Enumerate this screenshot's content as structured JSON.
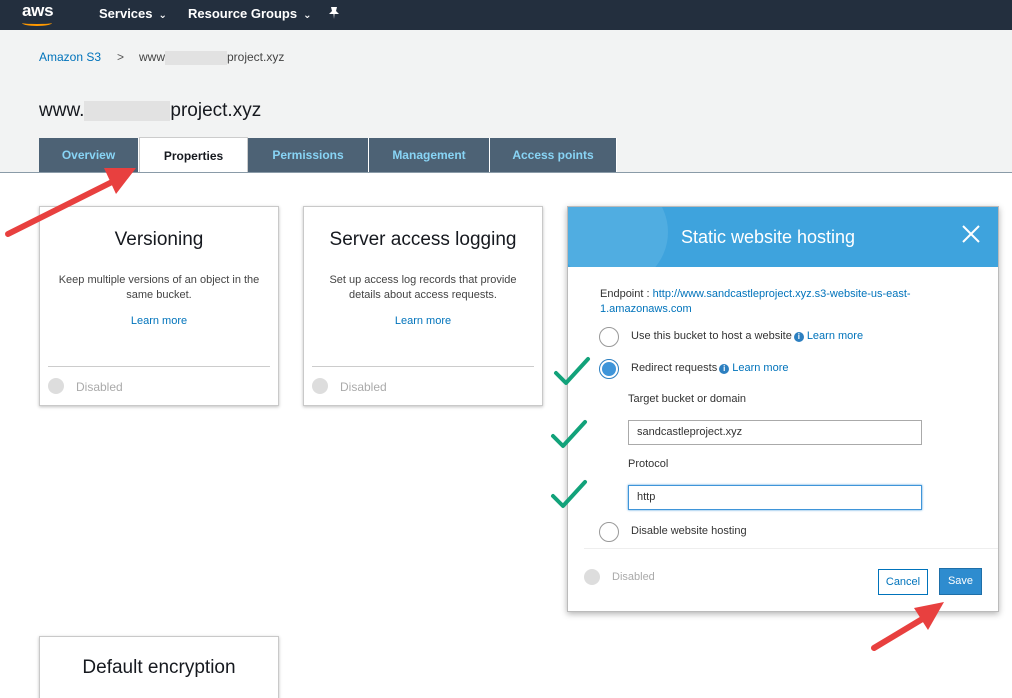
{
  "nav": {
    "logo": "aws",
    "services": "Services",
    "resource_groups": "Resource Groups",
    "chevron": "⌄",
    "pin_icon": "pin-icon"
  },
  "breadcrumb": {
    "root": "Amazon S3",
    "separator": ">",
    "current_prefix": "www",
    "current_suffix": "project.xyz"
  },
  "page": {
    "title_prefix": "www.",
    "title_suffix": "project.xyz"
  },
  "tabs": [
    {
      "label": "Overview"
    },
    {
      "label": "Properties"
    },
    {
      "label": "Permissions"
    },
    {
      "label": "Management"
    },
    {
      "label": "Access points"
    }
  ],
  "cards": {
    "versioning": {
      "title": "Versioning",
      "description": "Keep multiple versions of an object in the same bucket.",
      "link": "Learn more",
      "status": "Disabled"
    },
    "logging": {
      "title": "Server access logging",
      "description": "Set up access log records that provide details about access requests.",
      "link": "Learn more",
      "status": "Disabled"
    },
    "encryption": {
      "title": "Default encryption"
    }
  },
  "modal": {
    "title": "Static website hosting",
    "endpoint_label": "Endpoint :",
    "endpoint_url": "http://www.sandcastleproject.xyz.s3-website-us-east-1.amazonaws.com",
    "option_host": "Use this bucket to host a website",
    "option_redirect": "Redirect requests",
    "option_disable": "Disable website hosting",
    "learn_more": "Learn more",
    "target_label": "Target bucket or domain",
    "target_value": "sandcastleproject.xyz",
    "protocol_label": "Protocol",
    "protocol_value": "http",
    "status": "Disabled",
    "cancel": "Cancel",
    "save": "Save",
    "info_glyph": "i"
  },
  "colors": {
    "nav_bg": "#232f3e",
    "tab_bg": "#4d6275",
    "tab_text": "#88d4f5",
    "modal_header": "#3ea3dd",
    "link": "#0073bb",
    "save_button": "#2e8ccf",
    "annotation_arrow": "#e8403f",
    "annotation_check": "#12a27a"
  }
}
